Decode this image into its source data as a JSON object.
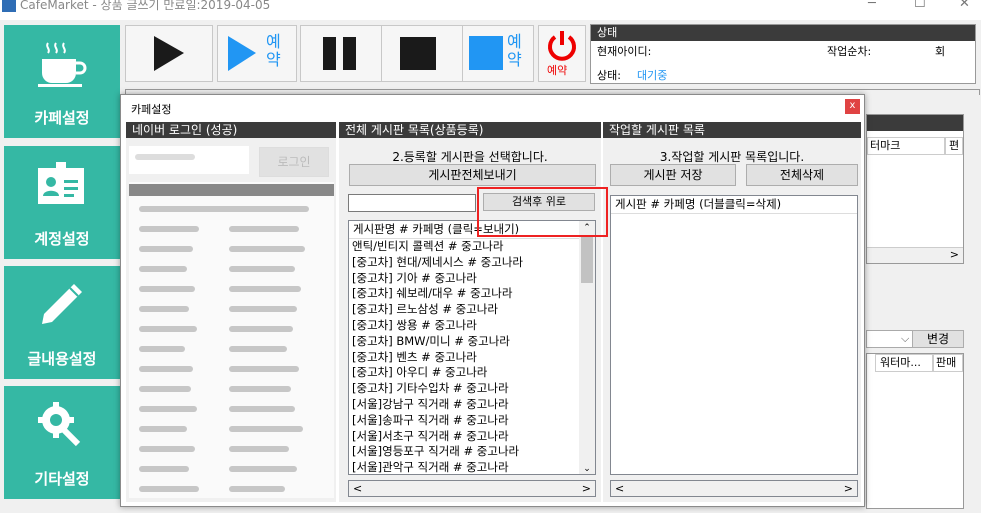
{
  "window": {
    "title": "CafeMarket - 상품 글쓰기 만료일:2019-04-05"
  },
  "sidebar": {
    "items": [
      {
        "label": "카페설정",
        "icon": "coffee-cup-icon"
      },
      {
        "label": "계정설정",
        "icon": "id-card-icon"
      },
      {
        "label": "글내용설정",
        "icon": "pencil-icon"
      },
      {
        "label": "기타설정",
        "icon": "wrench-gear-icon"
      }
    ]
  },
  "toolbar": {
    "reserve_label": "예\n약",
    "power_label": "예약"
  },
  "status": {
    "header": "상태",
    "current_id_label": "현재아이디:",
    "order_label": "작업순차:",
    "times_label": "회",
    "state_label": "상태:",
    "state_value": "대기중"
  },
  "background": {
    "col_watermark": "터마크",
    "col_f": "편",
    "change_button": "변경",
    "col_water": "워터마...",
    "col_sale": "판매"
  },
  "dialog": {
    "title": "카페설정",
    "close": "x",
    "login": {
      "header": "네이버 로그인 (성공)",
      "login_button": "로그인"
    },
    "boards": {
      "header": "전체 게시판 목록(상품등록)",
      "instruction": "2.등록할 게시판을 선택합니다.",
      "send_all_button": "게시판전체보내기",
      "search_value": "",
      "search_button": "검색후 위로",
      "list_header": "게시판명 # 카페명 (클릭=보내기)",
      "items": [
        "앤틱/빈티지 콜렉션 # 중고나라",
        "[중고차] 현대/제네시스 # 중고나라",
        "[중고차] 기아 # 중고나라",
        "[중고차] 쉐보레/대우 # 중고나라",
        "[중고차] 르노삼성 # 중고나라",
        "[중고차] 쌍용 # 중고나라",
        "[중고차] BMW/미니 # 중고나라",
        "[중고차] 벤츠 # 중고나라",
        "[중고차] 아우디 # 중고나라",
        "[중고차] 기타수입차 # 중고나라",
        "[서울]강남구 직거래 # 중고나라",
        "[서울]송파구 직거래 # 중고나라",
        "[서울]서초구 직거래 # 중고나라",
        "[서울]영등포구 직거래 # 중고나라",
        "[서울]관악구 직거래 # 중고나라"
      ]
    },
    "target": {
      "header": "작업할 게시판 목록",
      "instruction": "3.작업할 게시판 목록입니다.",
      "save_button": "게시판 저장",
      "delete_all_button": "전체삭제",
      "list_header": "게시판 # 카페명 (더블클릭=삭제)"
    }
  }
}
